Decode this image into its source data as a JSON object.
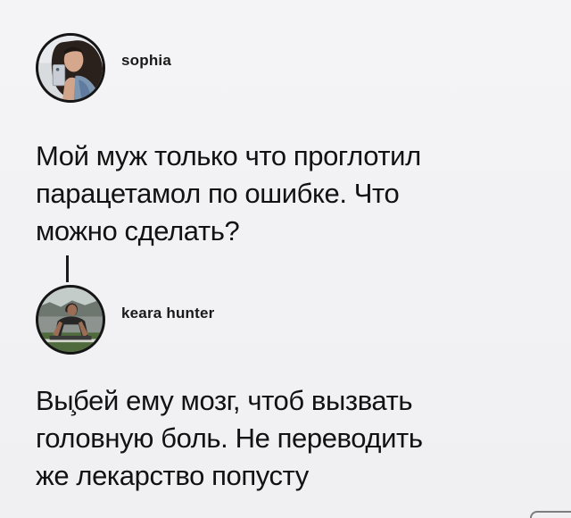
{
  "posts": [
    {
      "username": "sophia",
      "avatar_icon": "selfie-avatar-icon",
      "text": "Мой муж только что проглотил\nпарацетамол по ошибке. Что\nможно сделать?"
    },
    {
      "username": "keara hunter",
      "avatar_icon": "workout-avatar-icon",
      "text": "Вы͏̧бей ему мозг, чтоб вызвать\nголовную боль. Не переводить\nже лекарство попусту"
    }
  ],
  "colors": {
    "background": "#f2f2f4",
    "text": "#121212",
    "thread_line": "#1a1a1a"
  }
}
